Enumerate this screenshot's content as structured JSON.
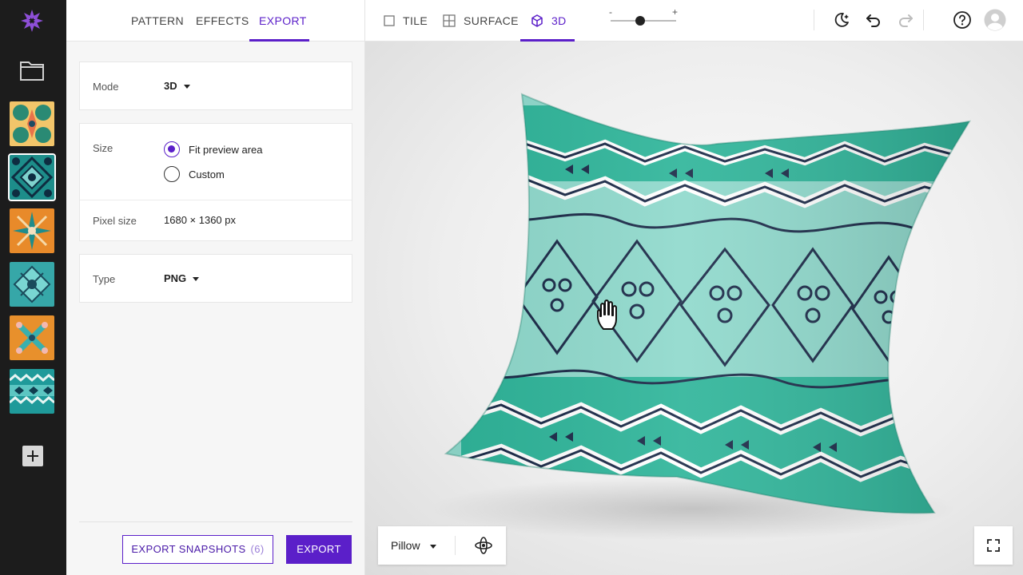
{
  "panel_tabs": [
    {
      "label": "PATTERN",
      "active": false
    },
    {
      "label": "EFFECTS",
      "active": false
    },
    {
      "label": "EXPORT",
      "active": true
    }
  ],
  "mode": {
    "label": "Mode",
    "value": "3D"
  },
  "size": {
    "label": "Size",
    "options": [
      {
        "label": "Fit preview area",
        "selected": true
      },
      {
        "label": "Custom",
        "selected": false
      }
    ],
    "pixel_label": "Pixel size",
    "pixel_value": "1680 × 1360 px"
  },
  "type": {
    "label": "Type",
    "value": "PNG"
  },
  "actions": {
    "export_snapshots_label": "EXPORT SNAPSHOTS",
    "export_snapshots_count": "(6)",
    "export_label": "EXPORT"
  },
  "view_tabs": [
    {
      "label": "TILE",
      "icon": "square-icon",
      "active": false
    },
    {
      "label": "SURFACE",
      "icon": "grid-icon",
      "active": false
    },
    {
      "label": "3D",
      "icon": "cube-icon",
      "active": true
    }
  ],
  "zoom": {
    "minus": "-",
    "plus": "+",
    "level": 0.45
  },
  "toolbar_icons": [
    "theme-toggle-icon",
    "undo-icon",
    "redo-icon",
    "help-icon",
    "avatar-icon"
  ],
  "model": {
    "value": "Pillow"
  },
  "sidebar_icons": [
    "logo-icon",
    "folder-icon",
    "add-icon"
  ],
  "colors": {
    "accent": "#5b1fc9",
    "rail": "#1c1c1c",
    "pillow_teal": "#2fb59a",
    "pillow_light": "#8fd9cc",
    "pattern_navy": "#1b2a48"
  }
}
